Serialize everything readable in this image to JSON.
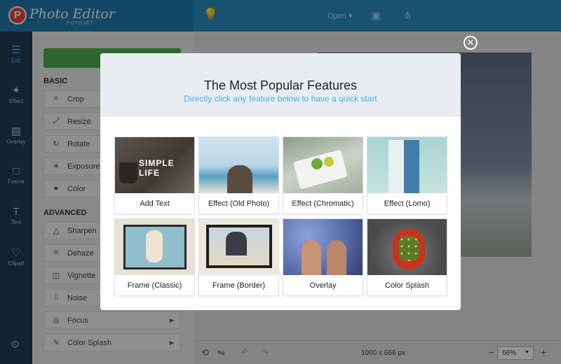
{
  "app": {
    "name": "Photo Editor",
    "sub": "FOTOJET",
    "logo_letter": "P"
  },
  "topbar": {
    "open_label": "Open",
    "icons": [
      "bulb-icon",
      "save-icon",
      "share-icon"
    ]
  },
  "rail": {
    "items": [
      {
        "label": "Edit",
        "icon": "sliders-icon"
      },
      {
        "label": "Effect",
        "icon": "wand-icon"
      },
      {
        "label": "Overlay",
        "icon": "stripes-icon"
      },
      {
        "label": "Frame",
        "icon": "frame-icon"
      },
      {
        "label": "Text",
        "icon": "text-icon"
      },
      {
        "label": "Clipart",
        "icon": "heart-icon"
      }
    ],
    "settings_icon": "gear-icon"
  },
  "panel": {
    "basic_title": "BASIC",
    "advanced_title": "ADVANCED",
    "basic_tools": [
      "Crop",
      "Resize",
      "Rotate",
      "Exposure",
      "Color"
    ],
    "advanced_tools": [
      "Sharpen",
      "Dehaze",
      "Vignette",
      "Noise",
      "Focus",
      "Color Splash"
    ]
  },
  "bottombar": {
    "dimensions": "1000 x 666 px",
    "zoom": "66%",
    "minus": "−",
    "plus": "+"
  },
  "modal": {
    "title": "The Most Popular Features",
    "subtitle": "Directly click any feature below to have a quick start",
    "close": "✕",
    "features": [
      {
        "label": "Add Text",
        "thumb_text": "SIMPLE LIFE"
      },
      {
        "label": "Effect (Old Photo)"
      },
      {
        "label": "Effect (Chromatic)"
      },
      {
        "label": "Effect (Lomo)"
      },
      {
        "label": "Frame (Classic)"
      },
      {
        "label": "Frame (Border)"
      },
      {
        "label": "Overlay"
      },
      {
        "label": "Color Splash"
      }
    ]
  },
  "colors": {
    "topbar": "#2b8cc2",
    "rail": "#223a53",
    "accent": "#45aee8",
    "apply": "#4caf50"
  }
}
